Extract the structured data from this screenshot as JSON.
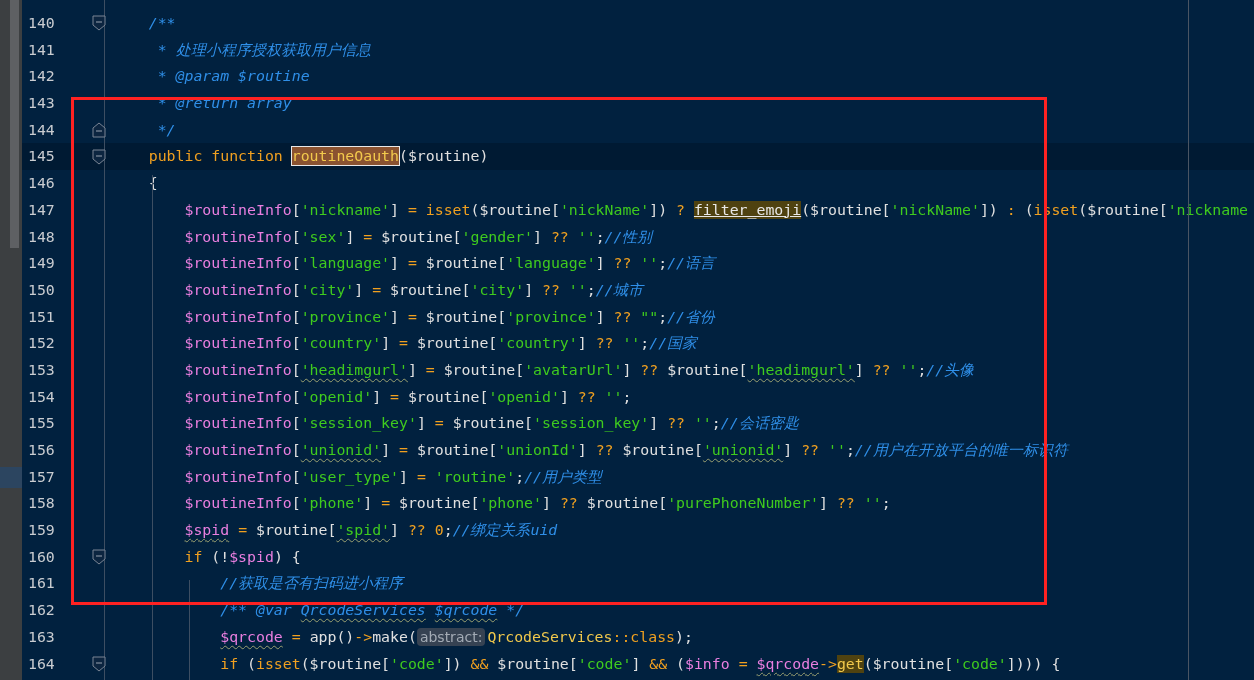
{
  "editor": {
    "lines": [
      {
        "number": "140",
        "current": false,
        "fold_start": true,
        "fold_end": false,
        "tokens": [
          {
            "kind": "c",
            "t": "    /**"
          }
        ]
      },
      {
        "number": "141",
        "current": false,
        "fold_start": false,
        "fold_end": false,
        "tokens": [
          {
            "kind": "c",
            "t": "     * 处理小程序授权获取用户信息"
          }
        ]
      },
      {
        "number": "142",
        "current": false,
        "fold_start": false,
        "fold_end": false,
        "tokens": [
          {
            "kind": "c",
            "t": "     * @param $routine"
          }
        ]
      },
      {
        "number": "143",
        "current": false,
        "fold_start": false,
        "fold_end": false,
        "tokens": [
          {
            "kind": "c",
            "t": "     * @return array"
          }
        ]
      },
      {
        "number": "144",
        "current": false,
        "fold_start": false,
        "fold_end": true,
        "tokens": [
          {
            "kind": "c",
            "t": "     */"
          }
        ]
      },
      {
        "number": "145",
        "current": true,
        "fold_start": true,
        "fold_end": false,
        "tokens": [
          {
            "kind": "o",
            "t": "    public function "
          },
          {
            "kind": "match",
            "t": "routineOauth"
          },
          {
            "kind": "p",
            "t": "($routine)"
          }
        ]
      },
      {
        "number": "146",
        "current": false,
        "fold_start": false,
        "fold_end": false,
        "tokens": [
          {
            "kind": "p",
            "t": "    {"
          }
        ]
      },
      {
        "number": "147",
        "current": false,
        "fold_start": false,
        "fold_end": false,
        "tokens": [
          {
            "kind": "v",
            "t": "        $routineInfo"
          },
          {
            "kind": "p",
            "t": "["
          },
          {
            "kind": "s",
            "t": "'nickname'"
          },
          {
            "kind": "p",
            "t": "]"
          },
          {
            "kind": "o",
            "t": " = isset"
          },
          {
            "kind": "p",
            "t": "($routine["
          },
          {
            "kind": "s",
            "t": "'nickName'"
          },
          {
            "kind": "p",
            "t": "])"
          },
          {
            "kind": "o",
            "t": " ? "
          },
          {
            "kind": "ref",
            "t": "filter_emoji"
          },
          {
            "kind": "p",
            "t": "($routine["
          },
          {
            "kind": "s",
            "t": "'nickName'"
          },
          {
            "kind": "p",
            "t": "])"
          },
          {
            "kind": "o",
            "t": " : "
          },
          {
            "kind": "p",
            "t": "("
          },
          {
            "kind": "o",
            "t": "isset"
          },
          {
            "kind": "p",
            "t": "($routine["
          },
          {
            "kind": "s",
            "t": "'nickname"
          }
        ]
      },
      {
        "number": "148",
        "current": false,
        "fold_start": false,
        "fold_end": false,
        "tokens": [
          {
            "kind": "v",
            "t": "        $routineInfo"
          },
          {
            "kind": "p",
            "t": "["
          },
          {
            "kind": "s",
            "t": "'sex'"
          },
          {
            "kind": "p",
            "t": "]"
          },
          {
            "kind": "o",
            "t": " = "
          },
          {
            "kind": "p",
            "t": "$routine["
          },
          {
            "kind": "s",
            "t": "'gender'"
          },
          {
            "kind": "p",
            "t": "]"
          },
          {
            "kind": "o",
            "t": " ?? "
          },
          {
            "kind": "s",
            "t": "''"
          },
          {
            "kind": "p",
            "t": ";"
          },
          {
            "kind": "c",
            "t": "//性别"
          }
        ]
      },
      {
        "number": "149",
        "current": false,
        "fold_start": false,
        "fold_end": false,
        "tokens": [
          {
            "kind": "v",
            "t": "        $routineInfo"
          },
          {
            "kind": "p",
            "t": "["
          },
          {
            "kind": "s",
            "t": "'language'"
          },
          {
            "kind": "p",
            "t": "]"
          },
          {
            "kind": "o",
            "t": " = "
          },
          {
            "kind": "p",
            "t": "$routine["
          },
          {
            "kind": "s",
            "t": "'language'"
          },
          {
            "kind": "p",
            "t": "]"
          },
          {
            "kind": "o",
            "t": " ?? "
          },
          {
            "kind": "s",
            "t": "''"
          },
          {
            "kind": "p",
            "t": ";"
          },
          {
            "kind": "c",
            "t": "//语言"
          }
        ]
      },
      {
        "number": "150",
        "current": false,
        "fold_start": false,
        "fold_end": false,
        "tokens": [
          {
            "kind": "v",
            "t": "        $routineInfo"
          },
          {
            "kind": "p",
            "t": "["
          },
          {
            "kind": "s",
            "t": "'city'"
          },
          {
            "kind": "p",
            "t": "]"
          },
          {
            "kind": "o",
            "t": " = "
          },
          {
            "kind": "p",
            "t": "$routine["
          },
          {
            "kind": "s",
            "t": "'city'"
          },
          {
            "kind": "p",
            "t": "]"
          },
          {
            "kind": "o",
            "t": " ?? "
          },
          {
            "kind": "s",
            "t": "''"
          },
          {
            "kind": "p",
            "t": ";"
          },
          {
            "kind": "c",
            "t": "//城市"
          }
        ]
      },
      {
        "number": "151",
        "current": false,
        "fold_start": false,
        "fold_end": false,
        "tokens": [
          {
            "kind": "v",
            "t": "        $routineInfo"
          },
          {
            "kind": "p",
            "t": "["
          },
          {
            "kind": "s",
            "t": "'province'"
          },
          {
            "kind": "p",
            "t": "]"
          },
          {
            "kind": "o",
            "t": " = "
          },
          {
            "kind": "p",
            "t": "$routine["
          },
          {
            "kind": "s",
            "t": "'province'"
          },
          {
            "kind": "p",
            "t": "]"
          },
          {
            "kind": "o",
            "t": " ?? "
          },
          {
            "kind": "s",
            "t": "\"\""
          },
          {
            "kind": "p",
            "t": ";"
          },
          {
            "kind": "c",
            "t": "//省份"
          }
        ]
      },
      {
        "number": "152",
        "current": false,
        "fold_start": false,
        "fold_end": false,
        "tokens": [
          {
            "kind": "v",
            "t": "        $routineInfo"
          },
          {
            "kind": "p",
            "t": "["
          },
          {
            "kind": "s",
            "t": "'country'"
          },
          {
            "kind": "p",
            "t": "]"
          },
          {
            "kind": "o",
            "t": " = "
          },
          {
            "kind": "p",
            "t": "$routine["
          },
          {
            "kind": "s",
            "t": "'country'"
          },
          {
            "kind": "p",
            "t": "]"
          },
          {
            "kind": "o",
            "t": " ?? "
          },
          {
            "kind": "s",
            "t": "''"
          },
          {
            "kind": "p",
            "t": ";"
          },
          {
            "kind": "c",
            "t": "//国家"
          }
        ]
      },
      {
        "number": "153",
        "current": false,
        "fold_start": false,
        "fold_end": false,
        "tokens": [
          {
            "kind": "v",
            "t": "        $routineInfo"
          },
          {
            "kind": "p",
            "t": "["
          },
          {
            "kind": "s",
            "t": "'headimgurl'",
            "typo": true
          },
          {
            "kind": "p",
            "t": "]"
          },
          {
            "kind": "o",
            "t": " = "
          },
          {
            "kind": "p",
            "t": "$routine["
          },
          {
            "kind": "s",
            "t": "'avatarUrl'"
          },
          {
            "kind": "p",
            "t": "]"
          },
          {
            "kind": "o",
            "t": " ?? "
          },
          {
            "kind": "p",
            "t": "$routine["
          },
          {
            "kind": "s",
            "t": "'headimgurl'",
            "typo": true
          },
          {
            "kind": "p",
            "t": "]"
          },
          {
            "kind": "o",
            "t": " ?? "
          },
          {
            "kind": "s",
            "t": "''"
          },
          {
            "kind": "p",
            "t": ";"
          },
          {
            "kind": "c",
            "t": "//头像"
          }
        ]
      },
      {
        "number": "154",
        "current": false,
        "fold_start": false,
        "fold_end": false,
        "tokens": [
          {
            "kind": "v",
            "t": "        $routineInfo"
          },
          {
            "kind": "p",
            "t": "["
          },
          {
            "kind": "s",
            "t": "'openid'"
          },
          {
            "kind": "p",
            "t": "]"
          },
          {
            "kind": "o",
            "t": " = "
          },
          {
            "kind": "p",
            "t": "$routine["
          },
          {
            "kind": "s",
            "t": "'openid'"
          },
          {
            "kind": "p",
            "t": "]"
          },
          {
            "kind": "o",
            "t": " ?? "
          },
          {
            "kind": "s",
            "t": "''"
          },
          {
            "kind": "p",
            "t": ";"
          }
        ]
      },
      {
        "number": "155",
        "current": false,
        "fold_start": false,
        "fold_end": false,
        "tokens": [
          {
            "kind": "v",
            "t": "        $routineInfo"
          },
          {
            "kind": "p",
            "t": "["
          },
          {
            "kind": "s",
            "t": "'session_key'"
          },
          {
            "kind": "p",
            "t": "]"
          },
          {
            "kind": "o",
            "t": " = "
          },
          {
            "kind": "p",
            "t": "$routine["
          },
          {
            "kind": "s",
            "t": "'session_key'"
          },
          {
            "kind": "p",
            "t": "]"
          },
          {
            "kind": "o",
            "t": " ?? "
          },
          {
            "kind": "s",
            "t": "''"
          },
          {
            "kind": "p",
            "t": ";"
          },
          {
            "kind": "c",
            "t": "//会话密匙"
          }
        ]
      },
      {
        "number": "156",
        "current": false,
        "fold_start": false,
        "fold_end": false,
        "tokens": [
          {
            "kind": "v",
            "t": "        $routineInfo"
          },
          {
            "kind": "p",
            "t": "["
          },
          {
            "kind": "s",
            "t": "'unionid'",
            "typo": true
          },
          {
            "kind": "p",
            "t": "]"
          },
          {
            "kind": "o",
            "t": " = "
          },
          {
            "kind": "p",
            "t": "$routine["
          },
          {
            "kind": "s",
            "t": "'unionId'"
          },
          {
            "kind": "p",
            "t": "]"
          },
          {
            "kind": "o",
            "t": " ?? "
          },
          {
            "kind": "p",
            "t": "$routine["
          },
          {
            "kind": "s",
            "t": "'unionid'",
            "typo": true
          },
          {
            "kind": "p",
            "t": "]"
          },
          {
            "kind": "o",
            "t": " ?? "
          },
          {
            "kind": "s",
            "t": "''"
          },
          {
            "kind": "p",
            "t": ";"
          },
          {
            "kind": "c",
            "t": "//用户在开放平台的唯一标识符"
          }
        ]
      },
      {
        "number": "157",
        "current": false,
        "fold_start": false,
        "fold_end": false,
        "tokens": [
          {
            "kind": "v",
            "t": "        $routineInfo"
          },
          {
            "kind": "p",
            "t": "["
          },
          {
            "kind": "s",
            "t": "'user_type'"
          },
          {
            "kind": "p",
            "t": "]"
          },
          {
            "kind": "o",
            "t": " = "
          },
          {
            "kind": "s",
            "t": "'routine'"
          },
          {
            "kind": "p",
            "t": ";"
          },
          {
            "kind": "c",
            "t": "//用户类型"
          }
        ]
      },
      {
        "number": "158",
        "current": false,
        "fold_start": false,
        "fold_end": false,
        "tokens": [
          {
            "kind": "v",
            "t": "        $routineInfo"
          },
          {
            "kind": "p",
            "t": "["
          },
          {
            "kind": "s",
            "t": "'phone'"
          },
          {
            "kind": "p",
            "t": "]"
          },
          {
            "kind": "o",
            "t": " = "
          },
          {
            "kind": "p",
            "t": "$routine["
          },
          {
            "kind": "s",
            "t": "'phone'"
          },
          {
            "kind": "p",
            "t": "]"
          },
          {
            "kind": "o",
            "t": " ?? "
          },
          {
            "kind": "p",
            "t": "$routine["
          },
          {
            "kind": "s",
            "t": "'purePhoneNumber'"
          },
          {
            "kind": "p",
            "t": "]"
          },
          {
            "kind": "o",
            "t": " ?? "
          },
          {
            "kind": "s",
            "t": "''"
          },
          {
            "kind": "p",
            "t": ";"
          }
        ]
      },
      {
        "number": "159",
        "current": false,
        "fold_start": false,
        "fold_end": false,
        "tokens": [
          {
            "kind": "v",
            "t": "        $spid",
            "typo": true
          },
          {
            "kind": "o",
            "t": " = "
          },
          {
            "kind": "p",
            "t": "$routine["
          },
          {
            "kind": "s",
            "t": "'spid'",
            "typo": true
          },
          {
            "kind": "p",
            "t": "]"
          },
          {
            "kind": "o",
            "t": " ?? 0"
          },
          {
            "kind": "p",
            "t": ";"
          },
          {
            "kind": "c",
            "t": "//绑定关系uid"
          }
        ]
      },
      {
        "number": "160",
        "current": false,
        "fold_start": true,
        "fold_end": false,
        "tokens": [
          {
            "kind": "o",
            "t": "        if "
          },
          {
            "kind": "p",
            "t": "(!"
          },
          {
            "kind": "v",
            "t": "$spid"
          },
          {
            "kind": "p",
            "t": ") {"
          }
        ]
      },
      {
        "number": "161",
        "current": false,
        "fold_start": false,
        "fold_end": false,
        "tokens": [
          {
            "kind": "c",
            "t": "            //获取是否有扫码进小程序"
          }
        ]
      },
      {
        "number": "162",
        "current": false,
        "fold_start": false,
        "fold_end": false,
        "tokens": [
          {
            "kind": "c",
            "t": "            /** @var "
          },
          {
            "kind": "c",
            "t": "QrcodeServices",
            "typo": true
          },
          {
            "kind": "c",
            "t": " $qrcode",
            "typo": true
          },
          {
            "kind": "c",
            "t": " */"
          }
        ]
      },
      {
        "number": "163",
        "current": false,
        "fold_start": false,
        "fold_end": false,
        "tokens": [
          {
            "kind": "v",
            "t": "            $qrcode",
            "typo": true
          },
          {
            "kind": "o",
            "t": " = "
          },
          {
            "kind": "p",
            "t": "app()"
          },
          {
            "kind": "o",
            "t": "->"
          },
          {
            "kind": "p",
            "t": "make("
          },
          {
            "kind": "hint",
            "t": "abstract:"
          },
          {
            "kind": "cls",
            "t": "QrcodeServices"
          },
          {
            "kind": "o",
            "t": "::class"
          },
          {
            "kind": "p",
            "t": ");"
          }
        ]
      },
      {
        "number": "164",
        "current": false,
        "fold_start": true,
        "fold_end": false,
        "tokens": [
          {
            "kind": "o",
            "t": "            if "
          },
          {
            "kind": "p",
            "t": "("
          },
          {
            "kind": "o",
            "t": "isset"
          },
          {
            "kind": "p",
            "t": "($routine["
          },
          {
            "kind": "s",
            "t": "'code'"
          },
          {
            "kind": "p",
            "t": "])"
          },
          {
            "kind": "o",
            "t": " && "
          },
          {
            "kind": "p",
            "t": "$routine["
          },
          {
            "kind": "s",
            "t": "'code'"
          },
          {
            "kind": "p",
            "t": "]"
          },
          {
            "kind": "o",
            "t": " && "
          },
          {
            "kind": "p",
            "t": "("
          },
          {
            "kind": "v",
            "t": "$info"
          },
          {
            "kind": "o",
            "t": " = "
          },
          {
            "kind": "v",
            "t": "$qrcode",
            "typo": true
          },
          {
            "kind": "o",
            "t": "->"
          },
          {
            "kind": "hl",
            "t": "get"
          },
          {
            "kind": "p",
            "t": "($routine["
          },
          {
            "kind": "s",
            "t": "'code'"
          },
          {
            "kind": "p",
            "t": "]))) {"
          }
        ]
      }
    ]
  }
}
